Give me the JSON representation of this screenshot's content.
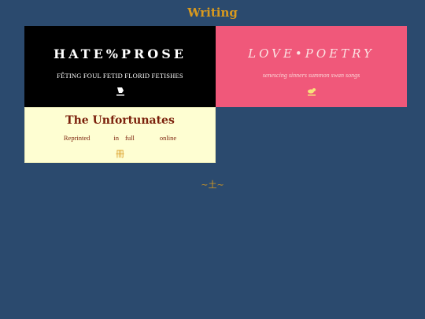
{
  "page": {
    "title": "Writing",
    "footer_mark": "~土~"
  },
  "cards": {
    "prose": {
      "title": "HATE%PROSE",
      "subtitle": "FÊTING FOUL FETID FLORID FETISHES",
      "icon": "quill-pen-icon",
      "icon_glyph": "✎",
      "background": "#000000"
    },
    "poetry": {
      "title": "LOVE•POETRY",
      "subtitle": "senescing sinners summon swan songs",
      "icon": "bird-icon",
      "icon_glyph": "🐦",
      "background": "#f0587a"
    },
    "unfortunates": {
      "title": "The Unfortunates",
      "subtitle_words": [
        "Reprinted",
        "in",
        "full",
        "online"
      ],
      "icon": "book-icon",
      "icon_glyph": "冊",
      "background": "#fefed2"
    }
  },
  "colors": {
    "page_background": "#2b4a6e",
    "accent": "#d99a1e",
    "unfortunates_text": "#7a1f0a"
  }
}
